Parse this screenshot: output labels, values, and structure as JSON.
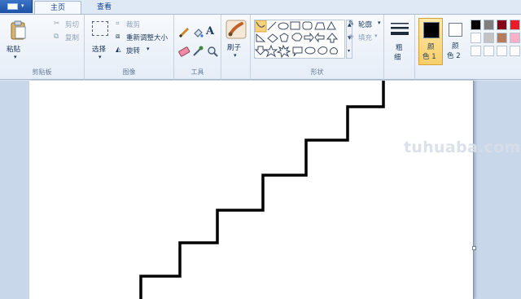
{
  "tabs": [
    {
      "label": "主页",
      "active": true
    },
    {
      "label": "查看",
      "active": false
    }
  ],
  "ribbon": {
    "clipboard": {
      "caption": "剪贴板",
      "paste": "粘贴",
      "cut": "剪切",
      "copy": "复制"
    },
    "image": {
      "caption": "图像",
      "select": "选择",
      "crop": "裁剪",
      "resize": "重新调整大小",
      "rotate": "旋转"
    },
    "tools": {
      "caption": "工具",
      "text_glyph": "A"
    },
    "brushes": {
      "label": "刷子"
    },
    "shapes": {
      "caption": "形状",
      "outline": "轮廓",
      "fill": "填充"
    },
    "size": {
      "label_top": "粗",
      "label_bottom": "细"
    },
    "colors": {
      "color1_top": "颜",
      "color1_bottom": "色 1",
      "color2_top": "颜",
      "color2_bottom": "色 2",
      "color1_value": "#000000",
      "color2_value": "#ffffff",
      "palette_row1": [
        "#000000",
        "#7f7f7f",
        "#880015",
        "#ed1c24"
      ],
      "palette_row2": [
        "#ffffff",
        "#c3c3c3",
        "#b97a57",
        "#ffaec9"
      ],
      "palette_row3": [
        "#ffffff",
        "#ffffff",
        "#ffffff",
        "#ffffff"
      ]
    }
  },
  "canvas": {
    "background": "#ffffff",
    "stroke_color": "#000000",
    "drawing": "staircase"
  },
  "watermark": "tuhuaba.com"
}
